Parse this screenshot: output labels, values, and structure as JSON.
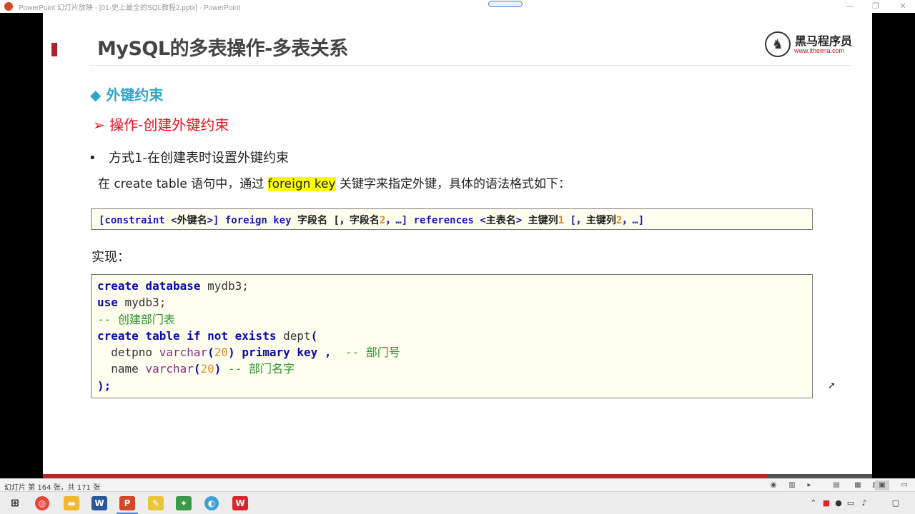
{
  "window": {
    "title": "PowerPoint 幻灯片放映 - [01-史上最全的SQL教程2.pptx] - PowerPoint",
    "minimize_glyph": "—",
    "restore_glyph": "❐",
    "close_glyph": "✕"
  },
  "slide": {
    "title": "MySQL的多表操作-多表关系",
    "logo": {
      "brand": "黑马程序员",
      "url": "www.itheima.com",
      "glyph": "♞"
    },
    "heading_diamond": "◆ 外键约束",
    "heading_arrow": "➢  操作-创建外键约束",
    "bullet_marker": "•",
    "bullet_text": "方式1-在创建表时设置外键约束",
    "intro": {
      "before": "在 create table 语句中，通过 ",
      "highlight": "foreign key",
      "after": " 关键字来指定外键，具体的语法格式如下："
    },
    "syntax": {
      "part1": "[constraint <",
      "part2": "外键名",
      "part3": ">] foreign key ",
      "part4": "字段名 [，字段名",
      "part5": "2",
      "part6": "，…] references <",
      "part7": "主表名",
      "part8": "> ",
      "part9": "主键列",
      "part10": "1",
      "part11": " [，",
      "part12": "主键列",
      "part13": "2",
      "part14": "，…]"
    },
    "impl_label": "实现：",
    "code": {
      "l1_kw": "create database",
      "l1_rest": " mydb3;",
      "l2_kw": "use",
      "l2_rest": " mydb3;",
      "l3_cm": "-- 创建部门表",
      "l4_kw": "create table if not exists",
      "l4_rest": " dept",
      "l4_paren": "(",
      "l5_name": "  detpno ",
      "l5_type": "varchar",
      "l5_p1": "(",
      "l5_num": "20",
      "l5_p2": ")",
      "l5_kw": " primary key ,",
      "l5_cm": "  -- 部门号",
      "l6_name": "  name ",
      "l6_type": "varchar",
      "l6_p1": "(",
      "l6_num": "20",
      "l6_p2": ")",
      "l6_cm": " -- 部门名字",
      "l7": ");"
    }
  },
  "slideshow_progress": 0.8737,
  "statusbar": {
    "slide_count": "幻灯片 第 164 张，共 171 张"
  },
  "taskbar": {
    "apps": [
      "start-menu",
      "chrome",
      "file-explorer",
      "word",
      "powerpoint",
      "pen-tool",
      "image-editor",
      "browser",
      "wps"
    ]
  },
  "colors": {
    "accent_red": "#c0222a",
    "heading_cyan": "#2aa7c9",
    "heading_red": "#e8101f",
    "highlight_yellow": "#ffff00"
  }
}
